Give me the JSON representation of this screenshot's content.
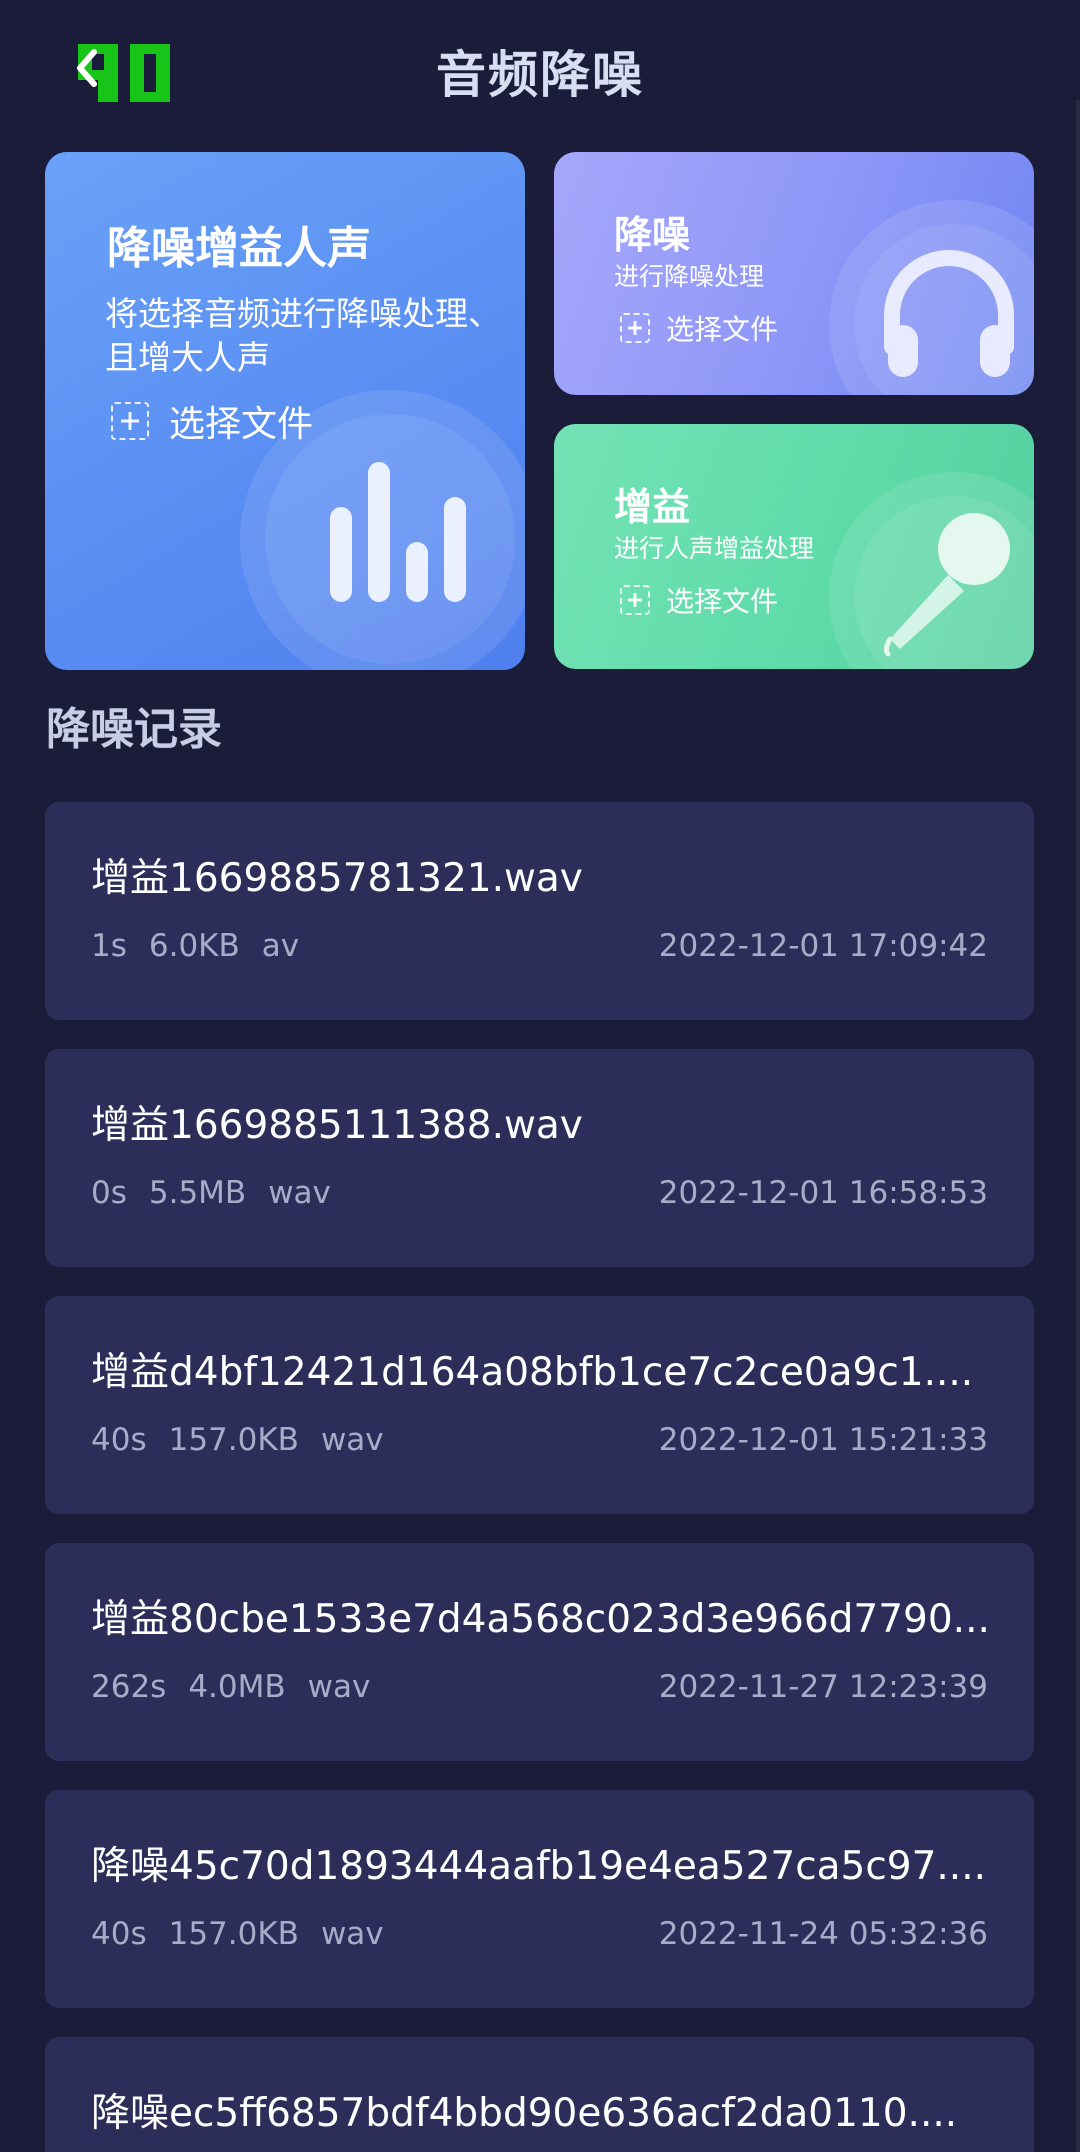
{
  "header": {
    "title": "音频降噪",
    "logo_text": "90",
    "back_icon": "chevron-left-icon"
  },
  "cards": {
    "main": {
      "title": "降噪增益人声",
      "desc": "将选择音频进行降噪处理、且增大人声",
      "choose": "选择文件",
      "icon": "sound-bars-icon"
    },
    "denoise": {
      "title": "降噪",
      "desc": "进行降噪处理",
      "choose": "选择文件",
      "icon": "headphones-icon"
    },
    "gain": {
      "title": "增益",
      "desc": "进行人声增益处理",
      "choose": "选择文件",
      "icon": "microphone-icon"
    }
  },
  "section": {
    "title": "降噪记录"
  },
  "records": [
    {
      "name": "增益1669885781321.wav",
      "duration": "1s",
      "size": "6.0KB",
      "format": "av",
      "time": "2022-12-01 17:09:42"
    },
    {
      "name": "增益1669885111388.wav",
      "duration": "0s",
      "size": "5.5MB",
      "format": "wav",
      "time": "2022-12-01 16:58:53"
    },
    {
      "name": "增益d4bf12421d164a08bfb1ce7c2ce0a9c1....",
      "duration": "40s",
      "size": "157.0KB",
      "format": "wav",
      "time": "2022-12-01 15:21:33"
    },
    {
      "name": "增益80cbe1533e7d4a568c023d3e966d7790...",
      "duration": "262s",
      "size": "4.0MB",
      "format": "wav",
      "time": "2022-11-27 12:23:39"
    },
    {
      "name": "降噪45c70d1893444aafb19e4ea527ca5c97....",
      "duration": "40s",
      "size": "157.0KB",
      "format": "wav",
      "time": "2022-11-24 05:32:36"
    },
    {
      "name": "降噪ec5ff6857bdf4bbd90e636acf2da0110....",
      "duration": "",
      "size": "",
      "format": "",
      "time": ""
    }
  ],
  "colors": {
    "background": "#1b1c3a",
    "record_card": "#2d2d59",
    "logo_green": "#18c418",
    "card_main": "#5a8ef3",
    "card_denoise": "#8f98f8",
    "card_gain": "#5fdbaa"
  }
}
